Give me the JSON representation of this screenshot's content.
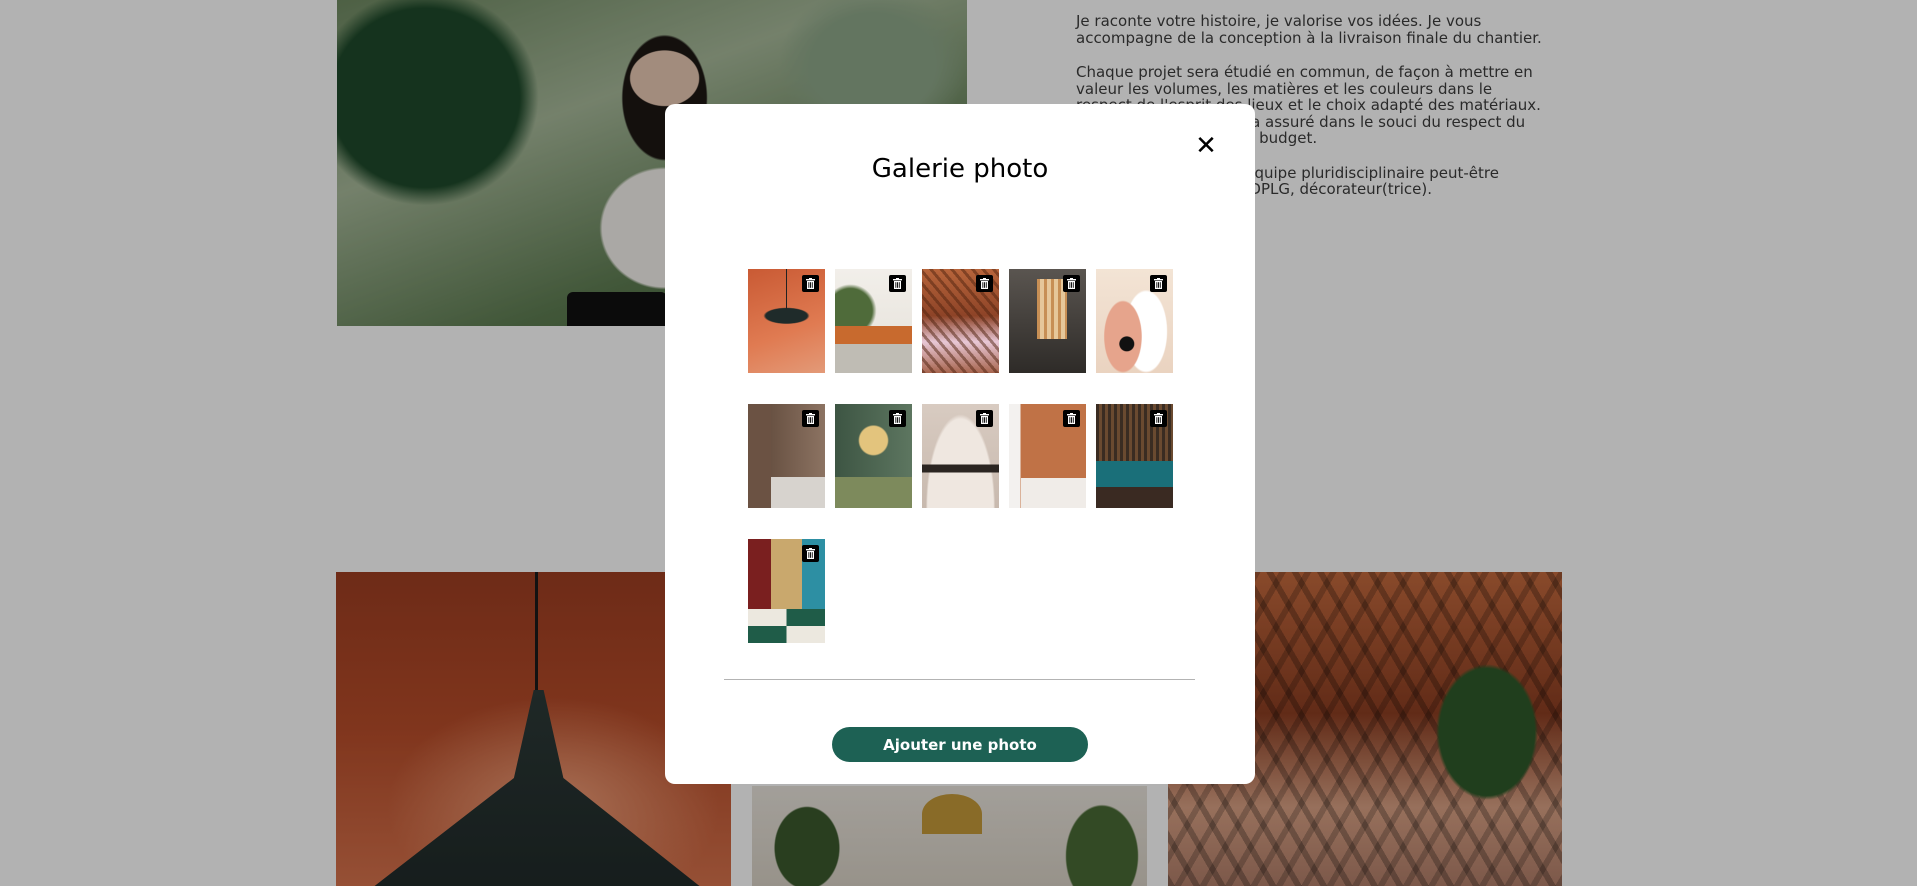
{
  "background_page": {
    "intro_paragraphs": [
      "Je raconte votre histoire, je valorise vos idées. Je vous accompagne de la conception à la livraison finale du chantier.",
      "Chaque projet sera étudié en commun, de façon à mettre en valeur les volumes, les matières et les couleurs dans le respect de l'esprit des lieux et le choix adapté des matériaux. Le suivi du chantier sera assuré dans le souci du respect du délai, du planning et du budget.",
      "En cas de besoin, une équipe pluridisciplinaire peut-être constituée : architecte DPLG, décorateur(trice)."
    ]
  },
  "modal": {
    "title": "Galerie photo",
    "close_icon": "close-icon",
    "add_button_label": "Ajouter une photo",
    "photos": [
      {
        "icon": "trash-icon"
      },
      {
        "icon": "trash-icon"
      },
      {
        "icon": "trash-icon"
      },
      {
        "icon": "trash-icon"
      },
      {
        "icon": "trash-icon"
      },
      {
        "icon": "trash-icon"
      },
      {
        "icon": "trash-icon"
      },
      {
        "icon": "trash-icon"
      },
      {
        "icon": "trash-icon"
      },
      {
        "icon": "trash-icon"
      },
      {
        "icon": "trash-icon"
      }
    ],
    "colors": {
      "button_bg": "#1d6154",
      "overlay": "rgba(0,0,0,0.30)"
    }
  }
}
